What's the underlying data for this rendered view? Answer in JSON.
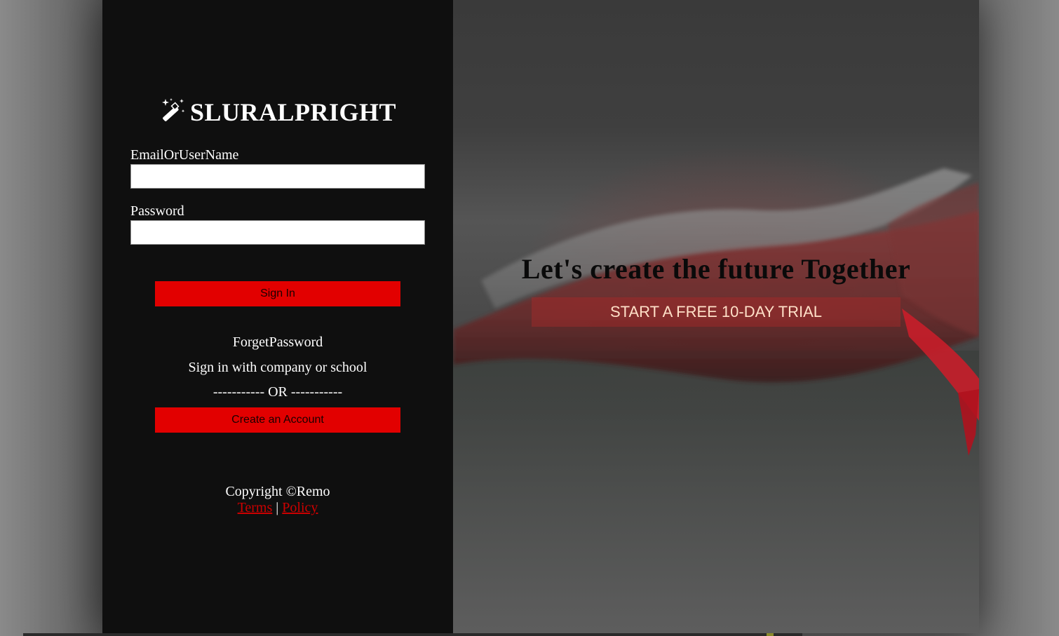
{
  "brand": {
    "name": "SLURALPRIGHT",
    "icon": "magic-wand-icon"
  },
  "login_form": {
    "email_label": "EmailOrUserName",
    "email_value": "",
    "password_label": "Password",
    "password_value": "",
    "sign_in_label": "Sign In",
    "forget_password_label": "ForgetPassword",
    "sso_label": "Sign in with company or school",
    "divider_text": "----------- OR -----------",
    "create_account_label": "Create an Account"
  },
  "footer": {
    "copyright": "Copyright ©Remo",
    "terms_label": "Terms",
    "separator": "|",
    "policy_label": "Policy"
  },
  "hero": {
    "title": "Let's create the future Together",
    "trial_label": "START A FREE 10-DAY TRIAL"
  },
  "colors": {
    "left_panel_bg": "#0f0f0f",
    "accent_red": "#e20000",
    "link_red": "#cc0000",
    "trial_text": "#ffe0c8"
  }
}
